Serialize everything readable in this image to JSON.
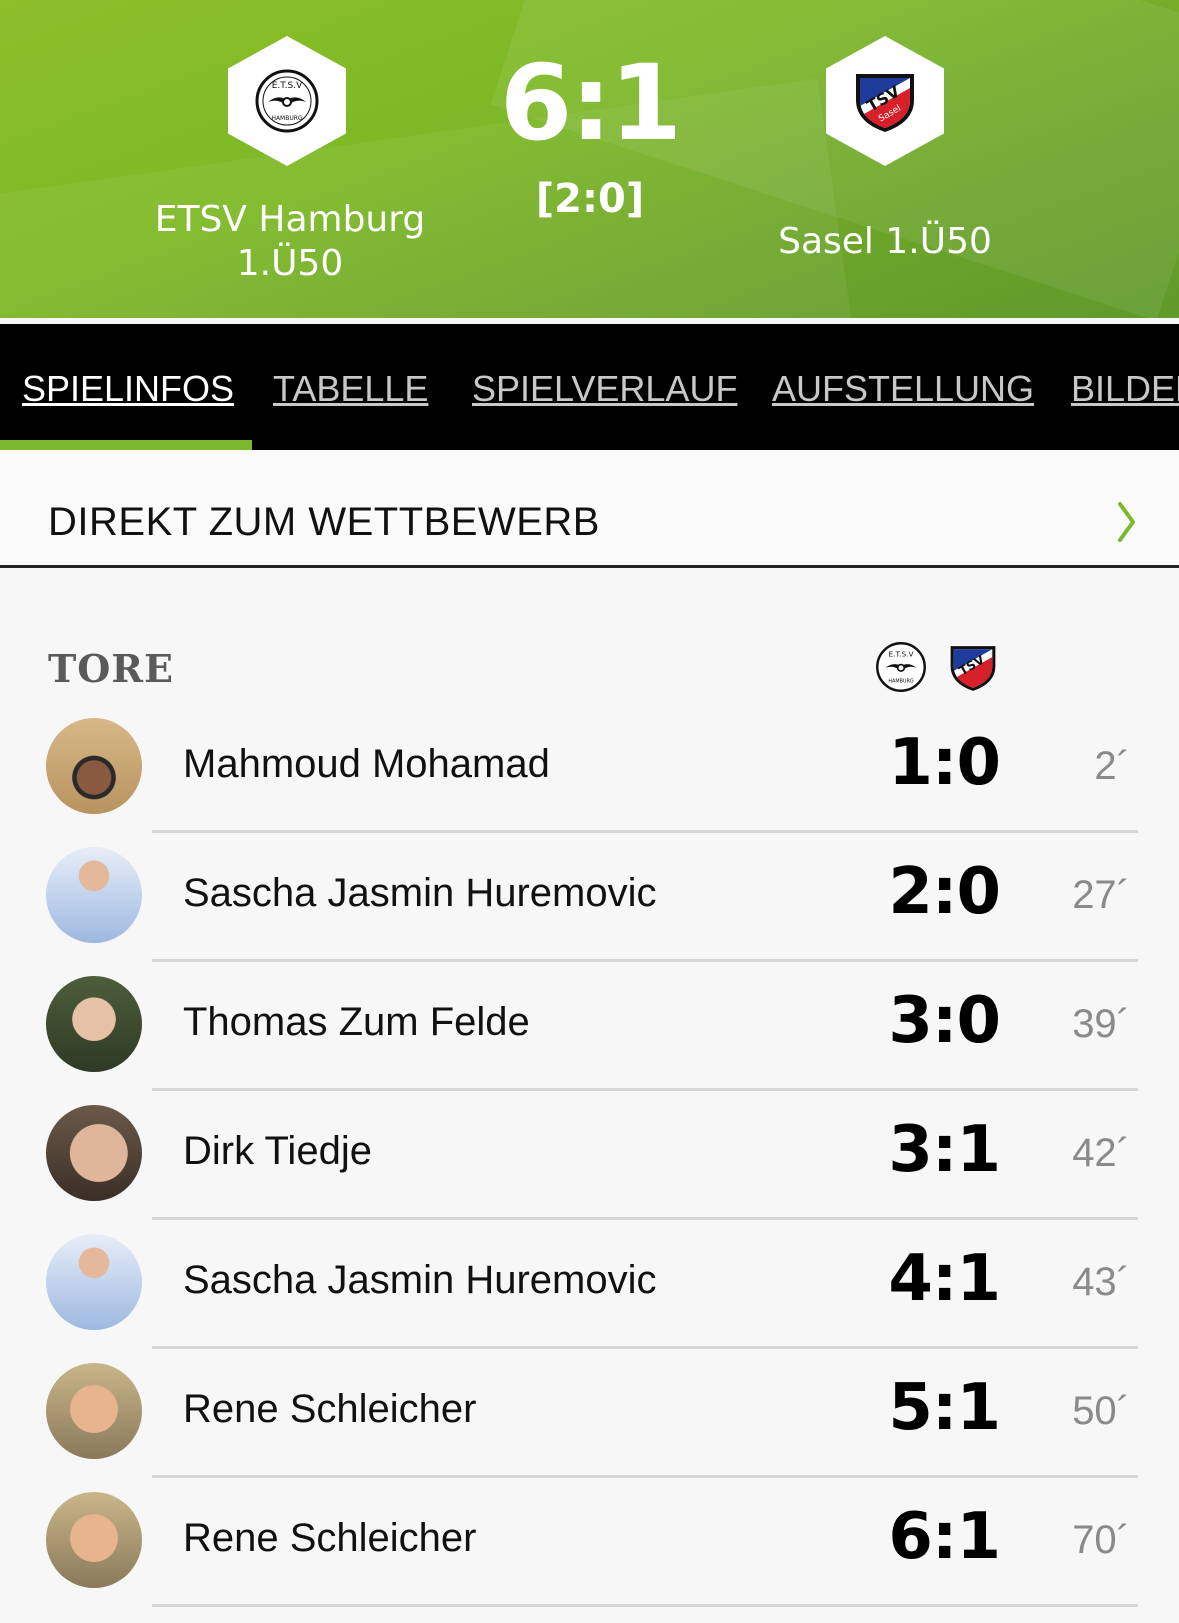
{
  "match": {
    "home_team": "ETSV Hamburg 1.Ü50",
    "away_team": "Sasel 1.Ü50",
    "score": "6:1",
    "halftime": "[2:0]",
    "home_logo_text": "E.T.S.V HAMBURG",
    "away_logo_text": "TSV Sasel"
  },
  "tabs": [
    "SPIELINFOS",
    "TABELLE",
    "SPIELVERLAUF",
    "AUFSTELLUNG",
    "BILDER"
  ],
  "active_tab": "SPIELINFOS",
  "direkt": {
    "label": "DIREKT ZUM WETTBEWERB"
  },
  "goals": {
    "title": "TORE",
    "items": [
      {
        "player": "Mahmoud Mohamad",
        "score": "1:0",
        "minute": "2´"
      },
      {
        "player": "Sascha Jasmin Huremovic",
        "score": "2:0",
        "minute": "27´"
      },
      {
        "player": "Thomas Zum Felde",
        "score": "3:0",
        "minute": "39´"
      },
      {
        "player": "Dirk Tiedje",
        "score": "3:1",
        "minute": "42´"
      },
      {
        "player": "Sascha Jasmin Huremovic",
        "score": "4:1",
        "minute": "43´"
      },
      {
        "player": "Rene Schleicher",
        "score": "5:1",
        "minute": "50´"
      },
      {
        "player": "Rene Schleicher",
        "score": "6:1",
        "minute": "70´"
      }
    ]
  },
  "colors": {
    "accent": "#7cb82f",
    "tabbar": "#000000",
    "saselBlue": "#1f3c9c",
    "saselRed": "#d6202a"
  }
}
